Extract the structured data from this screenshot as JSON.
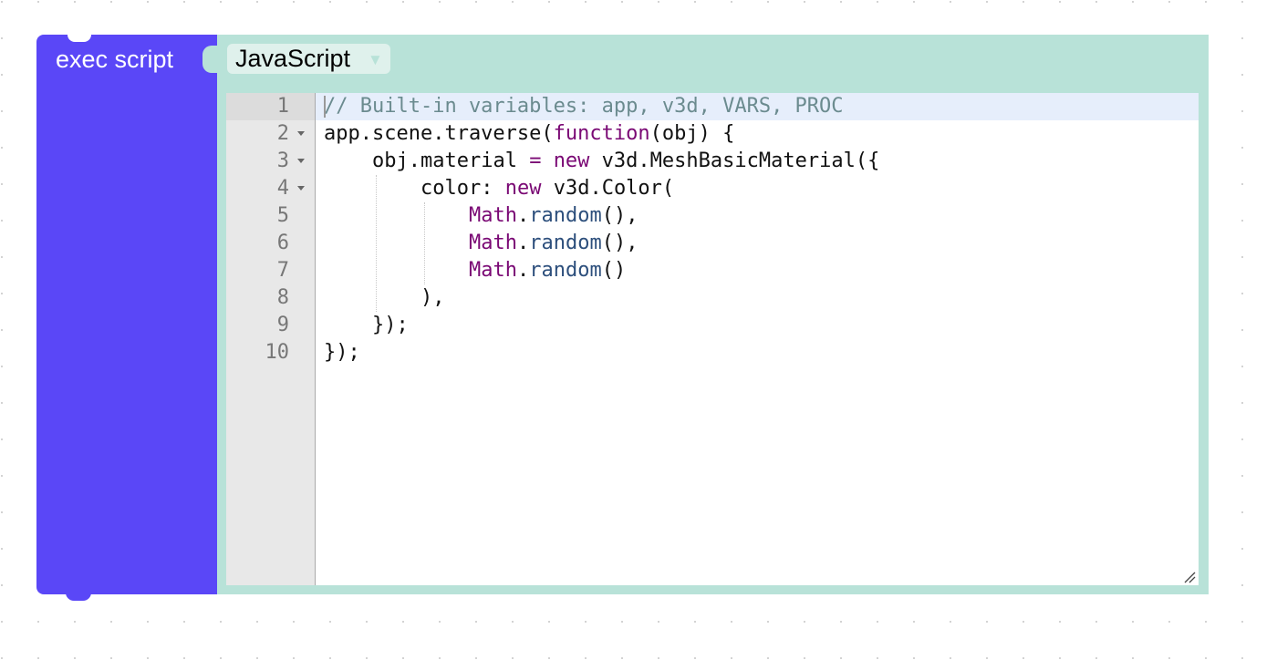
{
  "block": {
    "label": "exec script",
    "color": "#5a47f7",
    "panel_color": "#b8e2d8"
  },
  "language_dropdown": {
    "selected": "JavaScript",
    "arrow_icon": "triangle-down-icon"
  },
  "editor": {
    "active_line": 1,
    "lines": [
      {
        "number": "1",
        "foldable": false,
        "indent": 0,
        "code": "// Built-in variables: app, v3d, VARS, PROC"
      },
      {
        "number": "2",
        "foldable": true,
        "indent": 0,
        "code": "app.scene.traverse(function(obj) {"
      },
      {
        "number": "3",
        "foldable": true,
        "indent": 1,
        "code": "obj.material = new v3d.MeshBasicMaterial({"
      },
      {
        "number": "4",
        "foldable": true,
        "indent": 2,
        "code": "color: new v3d.Color("
      },
      {
        "number": "5",
        "foldable": false,
        "indent": 3,
        "code": "Math.random(),"
      },
      {
        "number": "6",
        "foldable": false,
        "indent": 3,
        "code": "Math.random(),"
      },
      {
        "number": "7",
        "foldable": false,
        "indent": 3,
        "code": "Math.random()"
      },
      {
        "number": "8",
        "foldable": false,
        "indent": 2,
        "code": "),"
      },
      {
        "number": "9",
        "foldable": false,
        "indent": 1,
        "code": "});"
      },
      {
        "number": "10",
        "foldable": false,
        "indent": 0,
        "code": "});"
      }
    ]
  }
}
